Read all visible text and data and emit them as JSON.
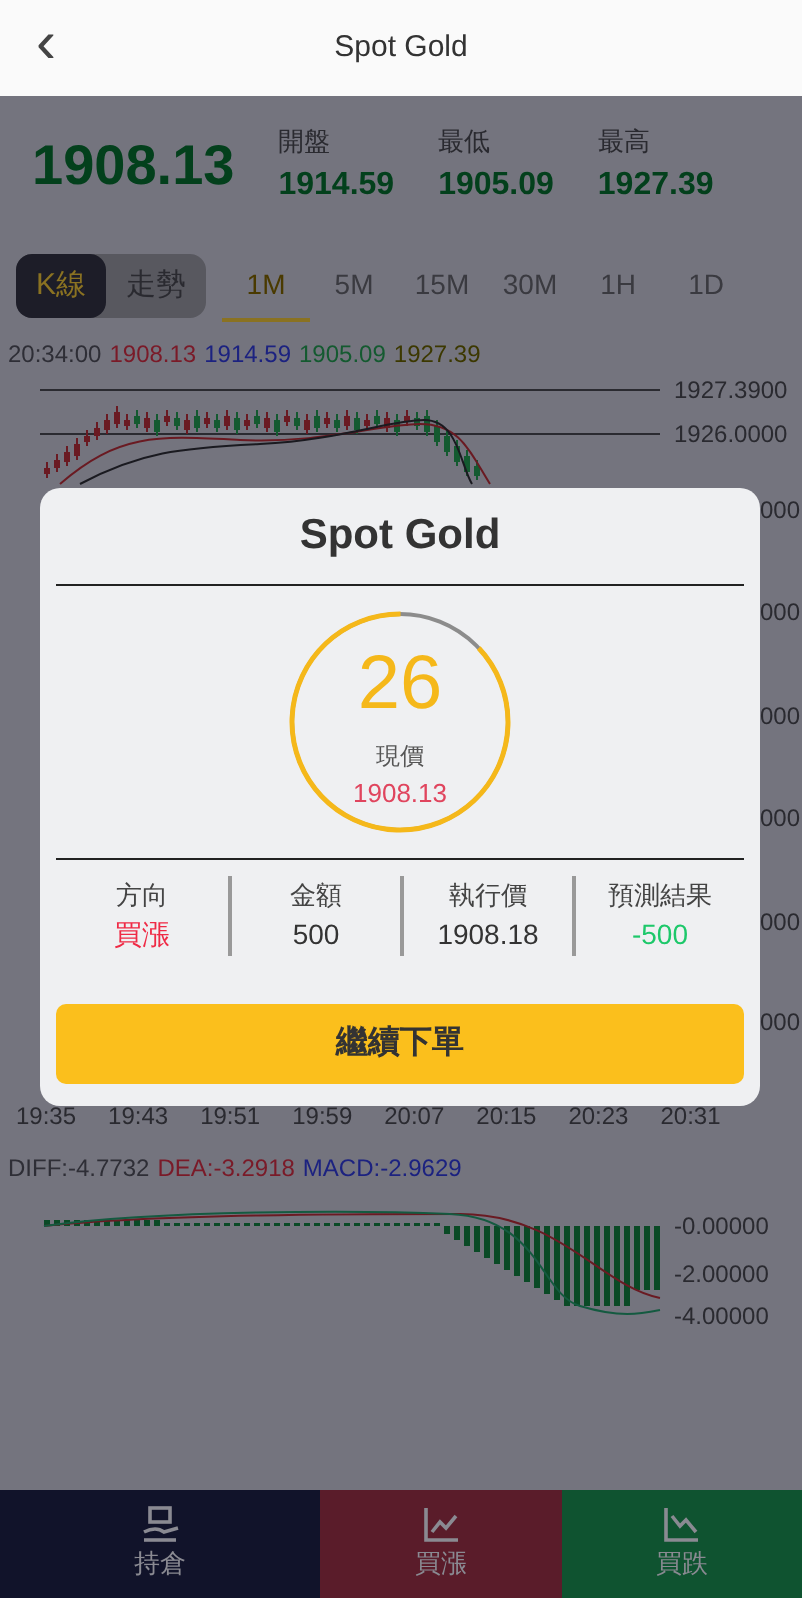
{
  "header": {
    "title": "Spot Gold",
    "back": "‹"
  },
  "quote": {
    "price": "1908.13",
    "stats": [
      {
        "label": "開盤",
        "value": "1914.59"
      },
      {
        "label": "最低",
        "value": "1905.09"
      },
      {
        "label": "最高",
        "value": "1927.39"
      }
    ]
  },
  "chart_modes": [
    {
      "label": "K線",
      "selected": true
    },
    {
      "label": "走勢",
      "selected": false
    }
  ],
  "intervals": [
    {
      "label": "1M",
      "selected": true
    },
    {
      "label": "5M",
      "selected": false
    },
    {
      "label": "15M",
      "selected": false
    },
    {
      "label": "30M",
      "selected": false
    },
    {
      "label": "1H",
      "selected": false
    },
    {
      "label": "1D",
      "selected": false
    }
  ],
  "ohlc_line": [
    {
      "text": "20:34:00",
      "color": "#2e2e36"
    },
    {
      "text": "1908.13",
      "color": "#7a1a28"
    },
    {
      "text": "1914.59",
      "color": "#1c2280"
    },
    {
      "text": "1905.09",
      "color": "#145a30"
    },
    {
      "text": "1927.39",
      "color": "#3c3800"
    }
  ],
  "price_axis": [
    "1927.3900",
    "1926.0000",
    "000",
    "000",
    "000",
    "000",
    "000",
    "000"
  ],
  "time_axis": [
    "19:35",
    "19:43",
    "19:51",
    "19:59",
    "20:07",
    "20:15",
    "20:23",
    "20:31"
  ],
  "macd_legend": [
    {
      "text": "DIFF:-4.7732",
      "color": "#2e2e36"
    },
    {
      "text": "DEA:-3.2918",
      "color": "#7a1a28"
    },
    {
      "text": "MACD:-2.9629",
      "color": "#1c2280"
    }
  ],
  "macd_axis": [
    "-0.00000",
    "-2.00000",
    "-4.00000"
  ],
  "modal": {
    "title": "Spot Gold",
    "countdown": "26",
    "level": 0.87,
    "price_label": "現價",
    "price": "1908.13",
    "details": [
      {
        "label": "方向",
        "value": "買漲",
        "kind": "up"
      },
      {
        "label": "金額",
        "value": "500",
        "kind": "plain"
      },
      {
        "label": "執行價",
        "value": "1908.18",
        "kind": "plain"
      },
      {
        "label": "預測結果",
        "value": "-500",
        "kind": "down"
      }
    ],
    "button": "繼續下單"
  },
  "bottom_nav": [
    {
      "label": "持倉",
      "kind": "positions"
    },
    {
      "label": "買漲",
      "kind": "buy-up"
    },
    {
      "label": "買跌",
      "kind": "buy-down"
    }
  ]
}
